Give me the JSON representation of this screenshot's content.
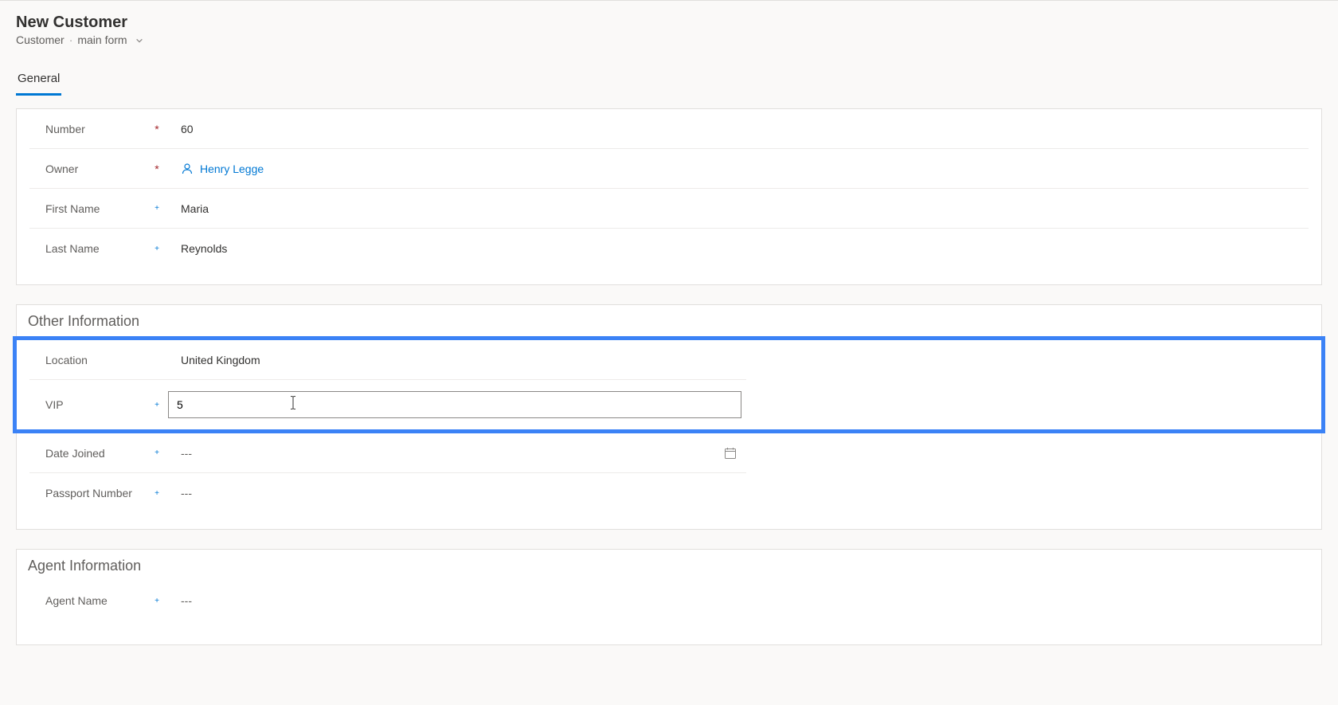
{
  "header": {
    "title": "New Customer",
    "breadcrumb_entity": "Customer",
    "breadcrumb_form": "main form"
  },
  "tabs": {
    "general": "General"
  },
  "fields": {
    "number": {
      "label": "Number",
      "value": "60"
    },
    "owner": {
      "label": "Owner",
      "value": "Henry Legge"
    },
    "first_name": {
      "label": "First Name",
      "value": "Maria"
    },
    "last_name": {
      "label": "Last Name",
      "value": "Reynolds"
    },
    "location": {
      "label": "Location",
      "value": "United Kingdom"
    },
    "vip": {
      "label": "VIP",
      "value": "5"
    },
    "date_joined": {
      "label": "Date Joined",
      "value": "---"
    },
    "passport_number": {
      "label": "Passport Number",
      "value": "---"
    },
    "agent_name": {
      "label": "Agent Name",
      "value": "---"
    }
  },
  "sections": {
    "other_info": "Other Information",
    "agent_info": "Agent Information"
  },
  "markers": {
    "required": "*",
    "recommended": "+"
  }
}
